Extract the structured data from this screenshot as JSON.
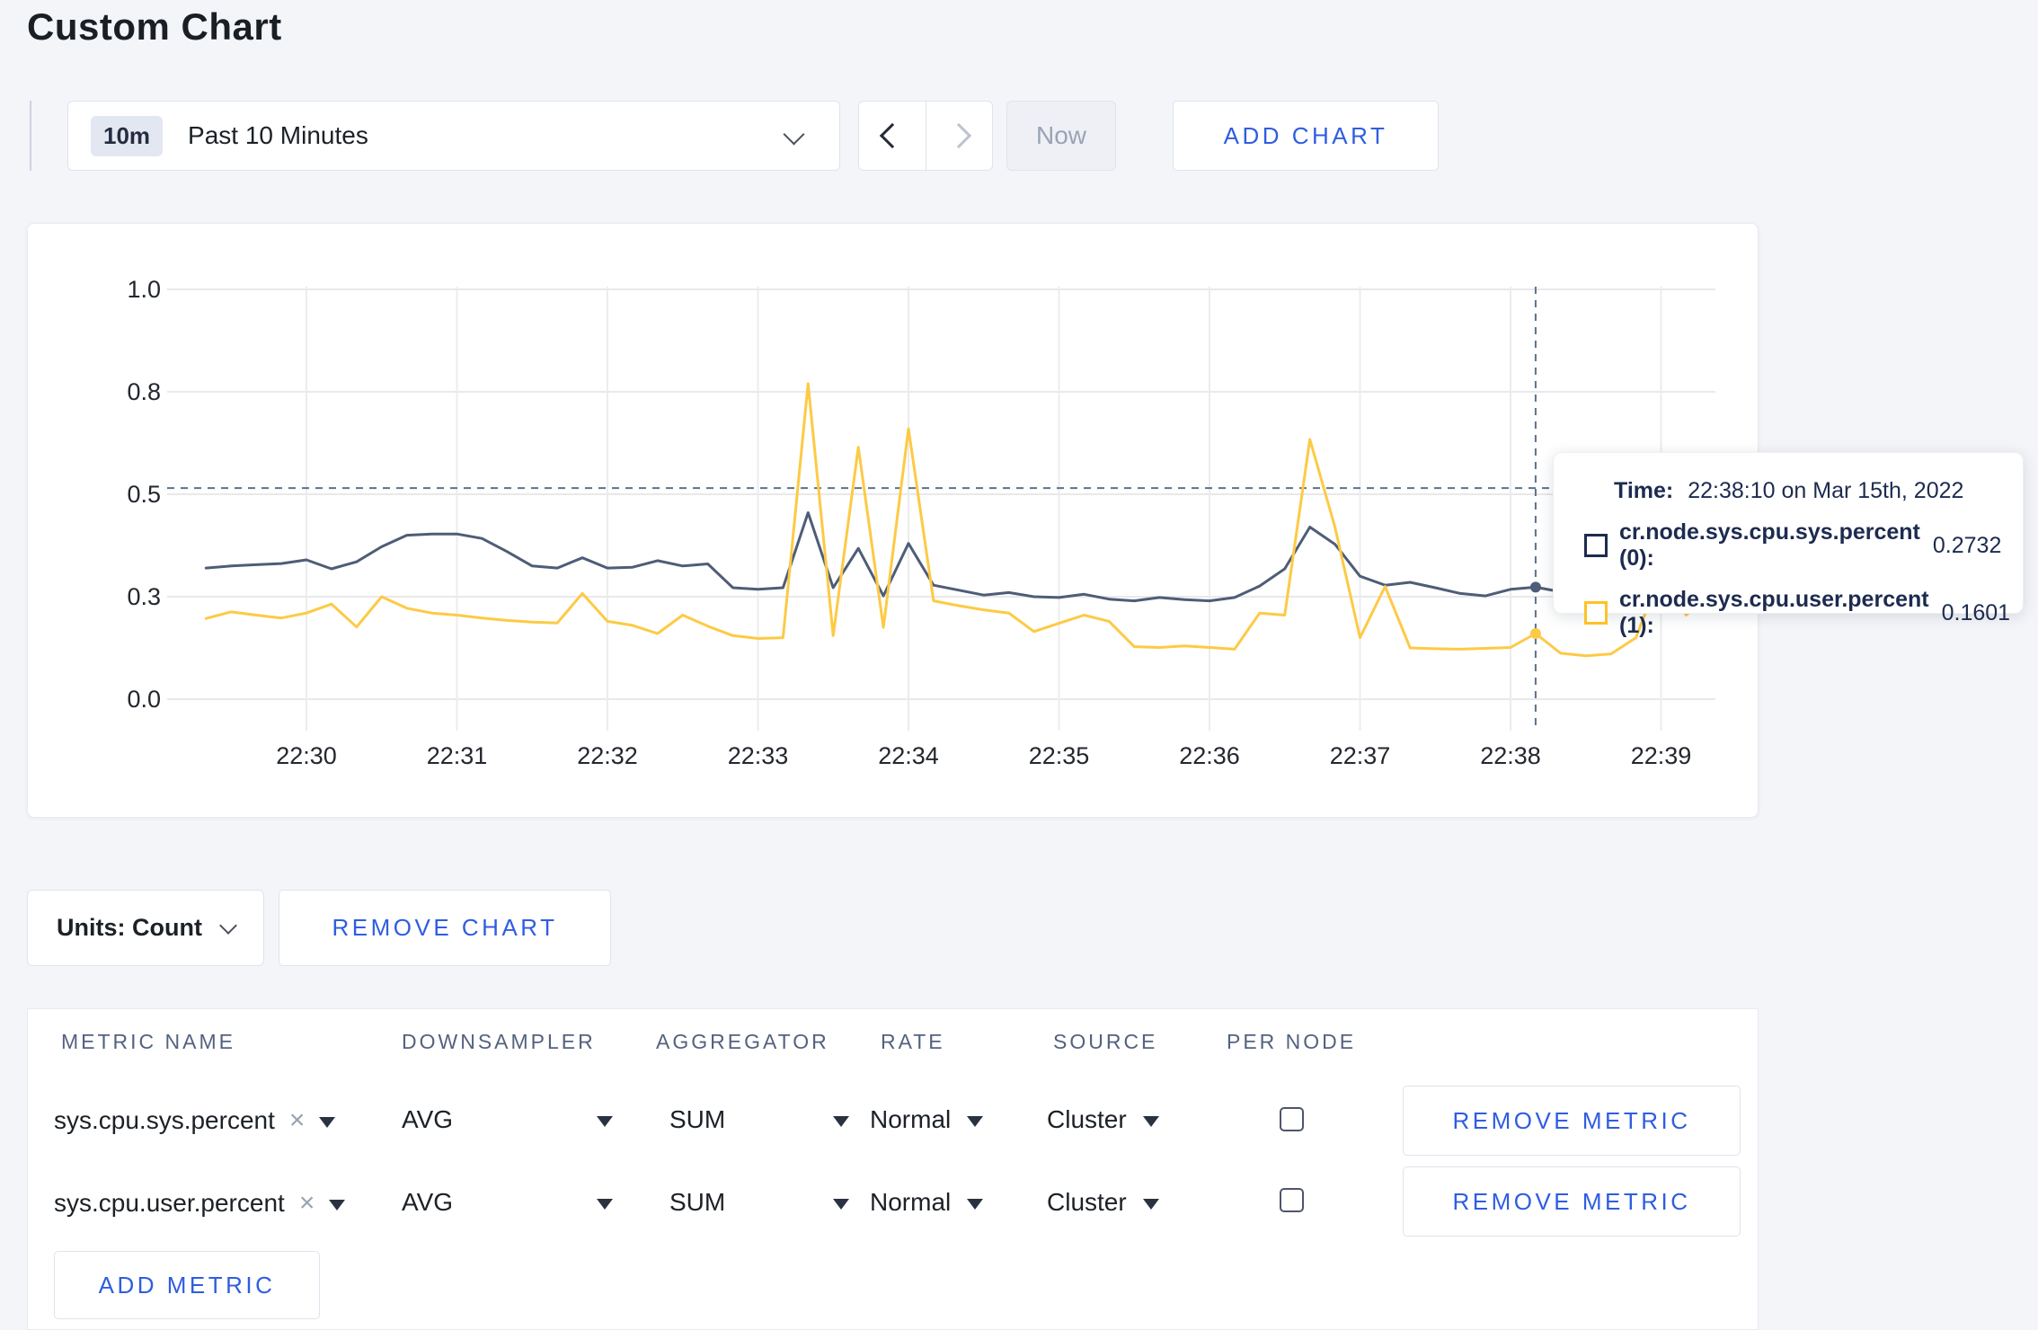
{
  "header": {
    "title": "Custom Chart"
  },
  "toolbar": {
    "range_badge": "10m",
    "range_label": "Past 10 Minutes",
    "now_label": "Now",
    "add_chart_label": "ADD CHART"
  },
  "chart_data": {
    "type": "line",
    "title": "",
    "xlabel": "",
    "ylabel": "",
    "ylim": [
      0,
      1
    ],
    "grid": true,
    "x_tick_labels": [
      "22:30",
      "22:31",
      "22:32",
      "22:33",
      "22:34",
      "22:35",
      "22:36",
      "22:37",
      "22:38",
      "22:39"
    ],
    "y_ticks": [
      {
        "label": "0.0",
        "value": 0
      },
      {
        "label": "0.3",
        "value": 0.25
      },
      {
        "label": "0.5",
        "value": 0.5
      },
      {
        "label": "0.8",
        "value": 0.75
      },
      {
        "label": "1.0",
        "value": 1.0
      }
    ],
    "start_time": "22:29:20",
    "interval_seconds": 10,
    "hline_value": 0.515,
    "crosshair": {
      "index": 53,
      "time": "22:38:10",
      "sys_value": 0.2732,
      "user_value": 0.1601
    },
    "series": [
      {
        "name": "cr.node.sys.cpu.sys.percent",
        "color": "#4e5d77",
        "values": [
          0.32,
          0.325,
          0.328,
          0.331,
          0.34,
          0.318,
          0.335,
          0.372,
          0.4,
          0.403,
          0.403,
          0.392,
          0.36,
          0.325,
          0.32,
          0.345,
          0.32,
          0.322,
          0.338,
          0.325,
          0.33,
          0.272,
          0.268,
          0.272,
          0.455,
          0.272,
          0.368,
          0.252,
          0.38,
          0.278,
          0.266,
          0.254,
          0.26,
          0.25,
          0.248,
          0.256,
          0.244,
          0.24,
          0.248,
          0.243,
          0.24,
          0.248,
          0.276,
          0.318,
          0.42,
          0.378,
          0.3,
          0.278,
          0.285,
          0.272,
          0.258,
          0.252,
          0.268,
          0.2732,
          0.262,
          0.255,
          0.262,
          0.27,
          0.264,
          0.258,
          0.264
        ]
      },
      {
        "name": "cr.node.sys.cpu.user.percent",
        "color": "#fdca45",
        "values": [
          0.197,
          0.213,
          0.205,
          0.198,
          0.21,
          0.232,
          0.176,
          0.25,
          0.222,
          0.21,
          0.205,
          0.198,
          0.192,
          0.188,
          0.186,
          0.258,
          0.19,
          0.18,
          0.16,
          0.205,
          0.178,
          0.155,
          0.148,
          0.15,
          0.77,
          0.155,
          0.615,
          0.175,
          0.66,
          0.24,
          0.228,
          0.218,
          0.21,
          0.165,
          0.185,
          0.205,
          0.19,
          0.128,
          0.126,
          0.13,
          0.126,
          0.122,
          0.21,
          0.205,
          0.634,
          0.42,
          0.15,
          0.275,
          0.125,
          0.123,
          0.122,
          0.124,
          0.126,
          0.1601,
          0.112,
          0.106,
          0.11,
          0.15,
          0.31,
          0.205,
          0.262
        ]
      }
    ]
  },
  "tooltip": {
    "time_label": "Time:",
    "time_value": "22:38:10 on Mar 15th, 2022",
    "rows": [
      {
        "name": "cr.node.sys.cpu.sys.percent (0):",
        "value": "0.2732",
        "color": "#1e2b4d"
      },
      {
        "name": "cr.node.sys.cpu.user.percent (1):",
        "value": "0.1601",
        "color": "#ffc125"
      }
    ]
  },
  "chart_controls": {
    "units_label": "Units: Count",
    "remove_chart_label": "REMOVE CHART"
  },
  "metrics_table": {
    "headers": [
      "METRIC NAME",
      "DOWNSAMPLER",
      "AGGREGATOR",
      "RATE",
      "SOURCE",
      "PER NODE"
    ],
    "rows": [
      {
        "metric": "sys.cpu.sys.percent",
        "downsampler": "AVG",
        "aggregator": "SUM",
        "rate": "Normal",
        "source": "Cluster",
        "per_node_checked": false,
        "remove_label": "REMOVE METRIC"
      },
      {
        "metric": "sys.cpu.user.percent",
        "downsampler": "AVG",
        "aggregator": "SUM",
        "rate": "Normal",
        "source": "Cluster",
        "per_node_checked": false,
        "remove_label": "REMOVE METRIC"
      }
    ],
    "add_metric_label": "ADD METRIC"
  },
  "colors": {
    "accent_blue": "#2f5de0",
    "page_background": "#f4f5f9",
    "series_sys": "#4e5d77",
    "series_user": "#fdca45",
    "crosshair_dash": "#5b728c"
  }
}
